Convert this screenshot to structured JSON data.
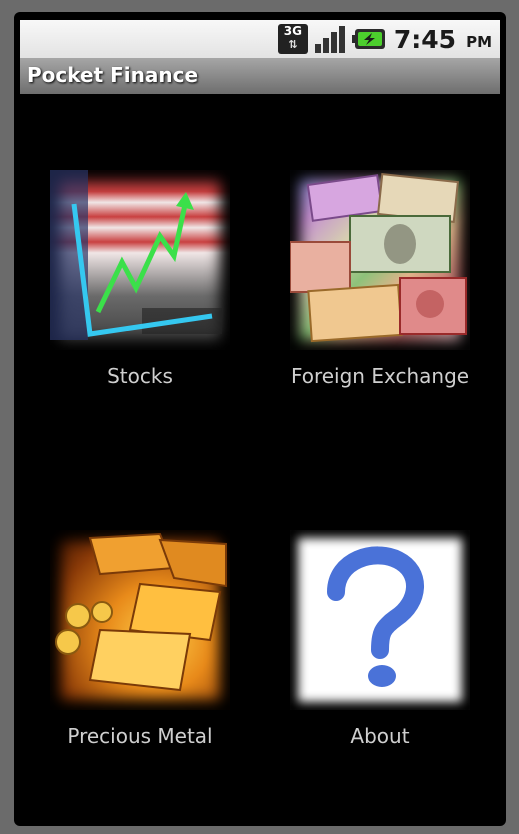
{
  "status_bar": {
    "network": "3G",
    "time": "7:45",
    "ampm": "PM"
  },
  "title_bar": {
    "title": "Pocket Finance"
  },
  "tiles": [
    {
      "label": "Stocks",
      "icon": "stocks-chart-icon"
    },
    {
      "label": "Foreign Exchange",
      "icon": "currency-notes-icon"
    },
    {
      "label": "Precious Metal",
      "icon": "gold-bars-icon"
    },
    {
      "label": "About",
      "icon": "question-mark-icon"
    }
  ],
  "colors": {
    "background": "#000000",
    "label": "#cfcfcf",
    "chart_axis": "#35c8f0",
    "chart_line": "#3be04a"
  }
}
